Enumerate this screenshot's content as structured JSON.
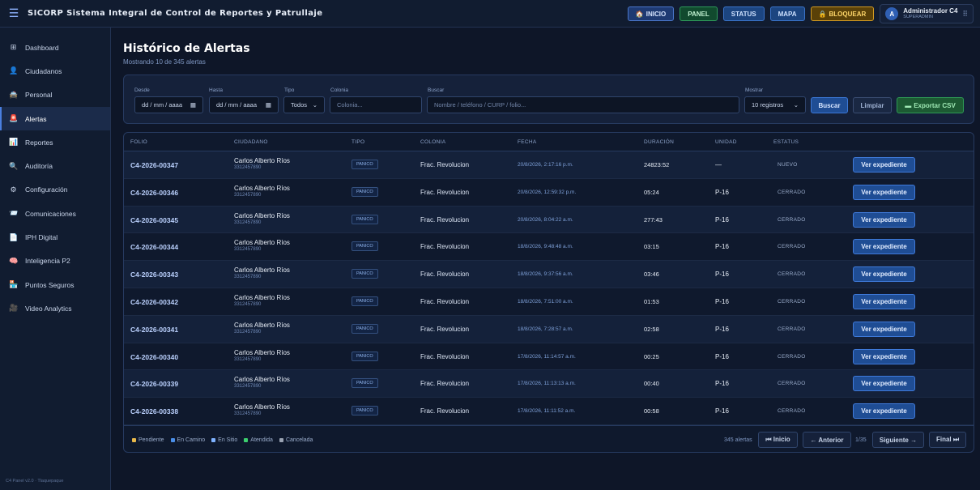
{
  "header": {
    "menu_icon": "hamburger-icon",
    "title": "SICORP Sistema Integral de Control de Reportes y Patrullaje",
    "buttons": {
      "inicio": "INICIO",
      "panel": "PANEL",
      "status": "STATUS",
      "mapa": "MAPA",
      "bloquear": "BLOQUEAR"
    },
    "user": {
      "initial": "A",
      "name": "Administrador C4",
      "role": "SUPERADMIN"
    }
  },
  "sidebar": {
    "items": [
      {
        "label": "Dashboard",
        "icon": "dashboard-icon",
        "glyph": "⊞"
      },
      {
        "label": "Ciudadanos",
        "icon": "citizens-icon",
        "glyph": "👤"
      },
      {
        "label": "Personal",
        "icon": "personnel-icon",
        "glyph": "🚔"
      },
      {
        "label": "Alertas",
        "icon": "alert-siren-icon",
        "glyph": "🚨"
      },
      {
        "label": "Reportes",
        "icon": "reports-chart-icon",
        "glyph": "📊"
      },
      {
        "label": "Auditoría",
        "icon": "audit-search-icon",
        "glyph": "🔍"
      },
      {
        "label": "Configuración",
        "icon": "settings-gear-icon",
        "glyph": "⚙"
      },
      {
        "label": "Comunicaciones",
        "icon": "communications-icon",
        "glyph": "📨"
      },
      {
        "label": "IPH Digital",
        "icon": "document-icon",
        "glyph": "📄"
      },
      {
        "label": "Inteligencia P2",
        "icon": "brain-icon",
        "glyph": "🧠"
      },
      {
        "label": "Puntos Seguros",
        "icon": "safe-points-icon",
        "glyph": "🏪"
      },
      {
        "label": "Video Analytics",
        "icon": "video-icon",
        "glyph": "🎥"
      }
    ],
    "active_index": 3,
    "footer": "C4 Panel v2.0 · Tlaquepaque"
  },
  "page": {
    "title": "Histórico de Alertas",
    "subtitle": "Mostrando 10 de 345 alertas"
  },
  "filters": {
    "desde_label": "Desde",
    "desde_value": "dd / mm / aaaa",
    "hasta_label": "Hasta",
    "hasta_value": "dd / mm / aaaa",
    "tipo_label": "Tipo",
    "tipo_value": "Todos",
    "colonia_label": "Colonia",
    "colonia_placeholder": "Colonia...",
    "buscar_label": "Buscar",
    "buscar_placeholder": "Nombre / teléfono / CURP / folio...",
    "mostrar_label": "Mostrar",
    "mostrar_value": "10 registros",
    "btn_buscar": "Buscar",
    "btn_limpiar": "Limpiar",
    "btn_exportar": "Exportar CSV"
  },
  "table": {
    "columns": [
      "FOLIO",
      "CIUDADANO",
      "TIPO",
      "COLONIA",
      "FECHA",
      "DURACIÓN",
      "UNIDAD",
      "ESTATUS"
    ],
    "action_label": "Ver expediente",
    "rows": [
      {
        "folio": "C4-2026-00347",
        "name": "Carlos Alberto Ríos",
        "phone": "3312457890",
        "tipo": "PANICO",
        "colonia": "Frac. Revolucion",
        "fecha": "20/8/2026, 2:17:16 p.m.",
        "duracion": "24823:52",
        "unidad": "—",
        "estatus": "NUEVO"
      },
      {
        "folio": "C4-2026-00346",
        "name": "Carlos Alberto Ríos",
        "phone": "3312457890",
        "tipo": "PANICO",
        "colonia": "Frac. Revolucion",
        "fecha": "20/8/2026, 12:59:32 p.m.",
        "duracion": "05:24",
        "unidad": "P-16",
        "estatus": "CERRADO"
      },
      {
        "folio": "C4-2026-00345",
        "name": "Carlos Alberto Ríos",
        "phone": "3312457890",
        "tipo": "PANICO",
        "colonia": "Frac. Revolucion",
        "fecha": "20/8/2026, 8:04:22 a.m.",
        "duracion": "277:43",
        "unidad": "P-16",
        "estatus": "CERRADO"
      },
      {
        "folio": "C4-2026-00344",
        "name": "Carlos Alberto Ríos",
        "phone": "3312457890",
        "tipo": "PANICO",
        "colonia": "Frac. Revolucion",
        "fecha": "18/8/2026, 9:48:48 a.m.",
        "duracion": "03:15",
        "unidad": "P-16",
        "estatus": "CERRADO"
      },
      {
        "folio": "C4-2026-00343",
        "name": "Carlos Alberto Ríos",
        "phone": "3312457890",
        "tipo": "PANICO",
        "colonia": "Frac. Revolucion",
        "fecha": "18/8/2026, 9:37:56 a.m.",
        "duracion": "03:46",
        "unidad": "P-16",
        "estatus": "CERRADO"
      },
      {
        "folio": "C4-2026-00342",
        "name": "Carlos Alberto Ríos",
        "phone": "3312457890",
        "tipo": "PANICO",
        "colonia": "Frac. Revolucion",
        "fecha": "18/8/2026, 7:51:00 a.m.",
        "duracion": "01:53",
        "unidad": "P-16",
        "estatus": "CERRADO"
      },
      {
        "folio": "C4-2026-00341",
        "name": "Carlos Alberto Ríos",
        "phone": "3312457890",
        "tipo": "PANICO",
        "colonia": "Frac. Revolucion",
        "fecha": "18/8/2026, 7:28:57 a.m.",
        "duracion": "02:58",
        "unidad": "P-16",
        "estatus": "CERRADO"
      },
      {
        "folio": "C4-2026-00340",
        "name": "Carlos Alberto Ríos",
        "phone": "3312457890",
        "tipo": "PANICO",
        "colonia": "Frac. Revolucion",
        "fecha": "17/8/2026, 11:14:57 a.m.",
        "duracion": "00:25",
        "unidad": "P-16",
        "estatus": "CERRADO"
      },
      {
        "folio": "C4-2026-00339",
        "name": "Carlos Alberto Ríos",
        "phone": "3312457890",
        "tipo": "PANICO",
        "colonia": "Frac. Revolucion",
        "fecha": "17/8/2026, 11:13:13 a.m.",
        "duracion": "00:40",
        "unidad": "P-16",
        "estatus": "CERRADO"
      },
      {
        "folio": "C4-2026-00338",
        "name": "Carlos Alberto Ríos",
        "phone": "3312457890",
        "tipo": "PANICO",
        "colonia": "Frac. Revolucion",
        "fecha": "17/8/2026, 11:11:52 a.m.",
        "duracion": "00:58",
        "unidad": "P-16",
        "estatus": "CERRADO"
      }
    ]
  },
  "legend": [
    {
      "label": "Pendiente",
      "color": "#e8b84a"
    },
    {
      "label": "En Camino",
      "color": "#4a8ee8"
    },
    {
      "label": "En Sitio",
      "color": "#7fb2ff"
    },
    {
      "label": "Atendida",
      "color": "#3ccf6e"
    },
    {
      "label": "Cancelada",
      "color": "#9aa3b3"
    }
  ],
  "pagination": {
    "total": "345 alertas",
    "inicio": "⏮ Inicio",
    "anterior": "← Anterior",
    "page_info": "1/35",
    "siguiente": "Siguiente →",
    "final": "Final ⏭"
  }
}
